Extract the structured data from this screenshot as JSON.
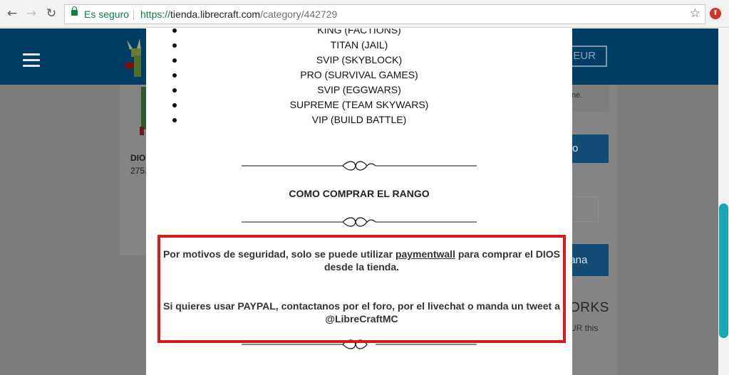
{
  "browser": {
    "secure_label": "Es seguro",
    "url_protocol": "https://",
    "url_host": "tienda.librecraft.com",
    "url_path": "/category/442729",
    "back_icon": "←",
    "forward_icon": "→",
    "reload_icon": "↻",
    "star_icon": "☆",
    "extension_icon": "⬆"
  },
  "page": {
    "currency_button": "EUR",
    "product_name": "DIO",
    "product_price": "275.",
    "right_text_1": "ne.",
    "right_button_1": "o",
    "right_button_2": "nana",
    "right_heading": "ORKS",
    "right_text_2": "UR this"
  },
  "modal": {
    "ranks": [
      "KING (FACTIONS)",
      "TITAN (JAIL)",
      "SVIP (SKYBLOCK)",
      "PRO (SURVIVAL GAMES)",
      "SVIP (EGGWARS)",
      "SUPREME (TEAM SKYWARS)",
      "VIP (BUILD BATTLE)"
    ],
    "section_title": "COMO COMPRAR EL RANGO",
    "notice": {
      "p1_before": "Por motivos de seguridad, solo se puede utilizar ",
      "p1_link": "paymentwall",
      "p1_after": " para comprar el DIOS desde la tienda.",
      "p2": "Si quieres usar PAYPAL, contactanos por el foro, por el livechat o manda un tweet a @LibreCraftMC"
    }
  },
  "colors": {
    "header": "#003d64",
    "overlay": "#7c7c7c",
    "notice_border": "#d71920",
    "scroll_thumb": "#16a6b6"
  }
}
